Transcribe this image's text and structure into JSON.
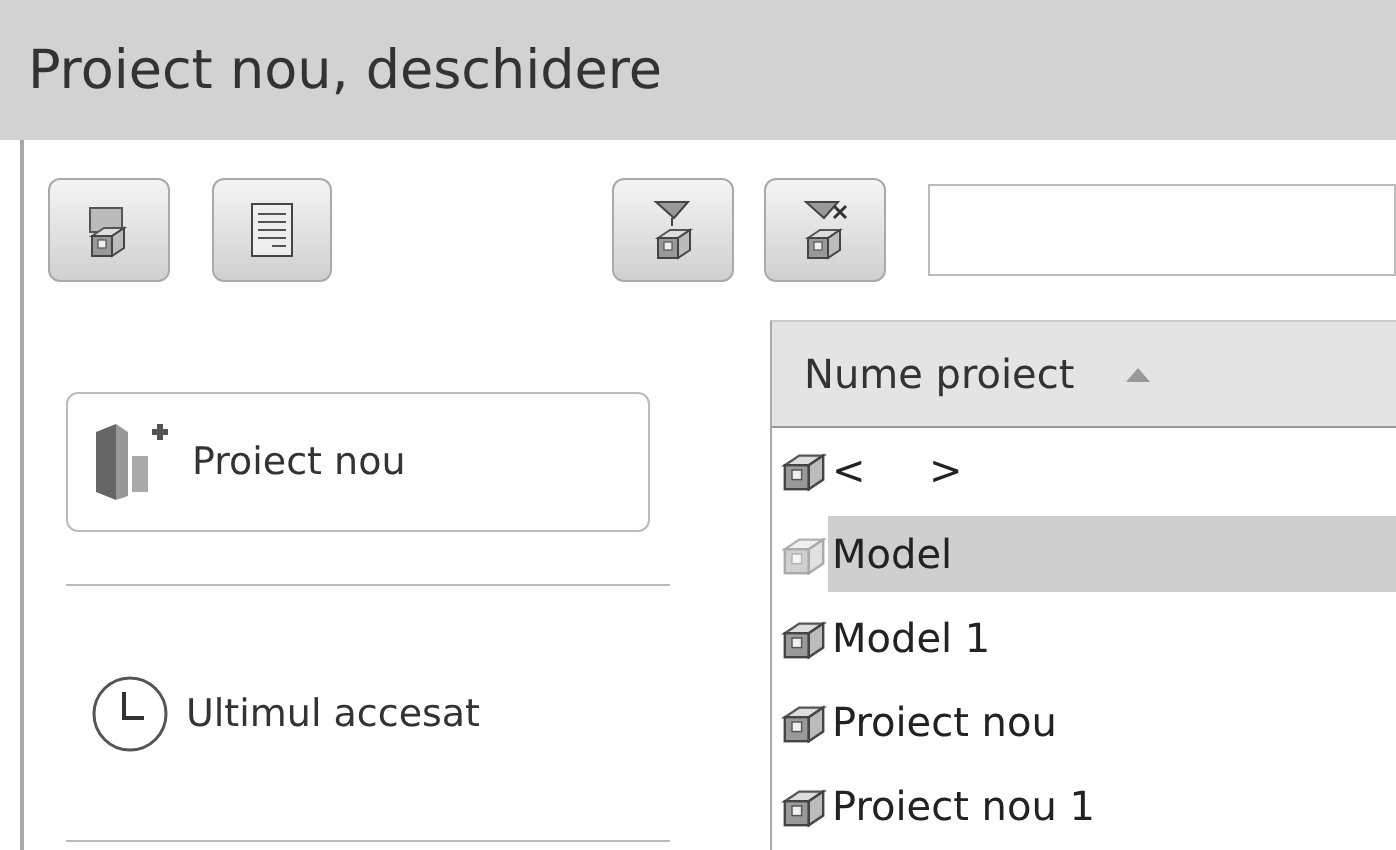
{
  "window": {
    "title": "Proiect nou, deschidere"
  },
  "sidebar": {
    "new_project_button": "Proiect nou",
    "recent": "Ultimul accesat"
  },
  "table": {
    "columns": [
      {
        "label": "Nume proiect",
        "sorted": true
      }
    ],
    "rows": [
      {
        "name": "<     >",
        "selected": false
      },
      {
        "name": "Model",
        "selected": true
      },
      {
        "name": "Model 1",
        "selected": false
      },
      {
        "name": "Proiect nou",
        "selected": false
      },
      {
        "name": "Proiect nou 1",
        "selected": false
      }
    ]
  }
}
